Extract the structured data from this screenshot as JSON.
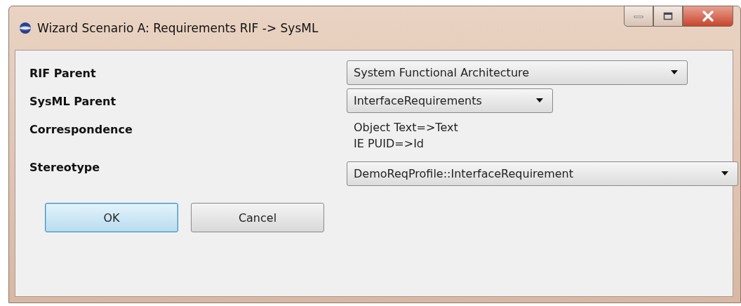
{
  "window": {
    "title": "Wizard Scenario A: Requirements RIF -> SysML"
  },
  "fields": [
    {
      "kind": "combo",
      "label": "RIF Parent",
      "value": "System Functional Architecture"
    },
    {
      "kind": "combo",
      "label": "SysML Parent",
      "value": "InterfaceRequirements"
    },
    {
      "kind": "text",
      "label": "Correspondence",
      "lines": [
        "Object Text=>Text",
        "IE PUID=>Id"
      ]
    },
    {
      "kind": "combo",
      "label": "Stereotype",
      "value": "DemoReqProfile::InterfaceRequirement"
    }
  ],
  "buttons": [
    {
      "label": "OK",
      "default": true
    },
    {
      "label": "Cancel",
      "default": false
    }
  ]
}
